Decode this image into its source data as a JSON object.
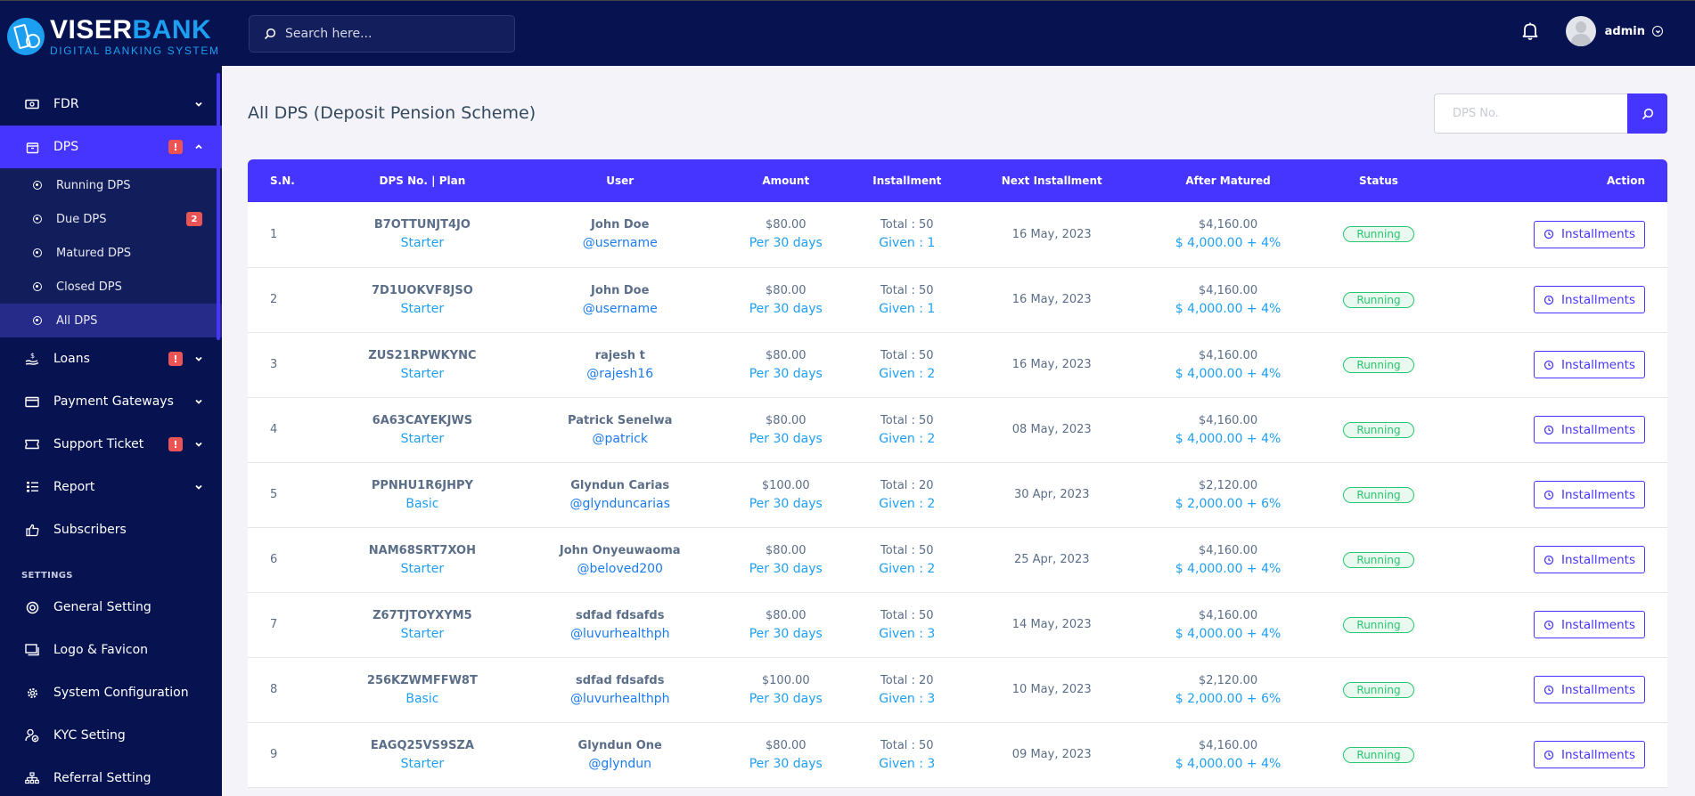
{
  "brand": {
    "name_part1": "VISER",
    "name_part2": "BANK",
    "tagline": "DIGITAL BANKING SYSTEM"
  },
  "sidebar": {
    "items": [
      {
        "label": "FDR",
        "icon": "money-bill-icon",
        "expanded": false
      },
      {
        "label": "DPS",
        "icon": "archive-icon",
        "alert": "!",
        "expanded": true,
        "active": true,
        "children": [
          {
            "label": "Running DPS"
          },
          {
            "label": "Due DPS",
            "badge": "2"
          },
          {
            "label": "Matured DPS"
          },
          {
            "label": "Closed DPS"
          },
          {
            "label": "All DPS",
            "active": true
          }
        ]
      },
      {
        "label": "Loans",
        "icon": "hand-holding-dollar-icon",
        "alert": "!"
      },
      {
        "label": "Payment Gateways",
        "icon": "credit-card-icon"
      },
      {
        "label": "Support Ticket",
        "icon": "ticket-icon",
        "alert": "!"
      },
      {
        "label": "Report",
        "icon": "list-icon"
      },
      {
        "label": "Subscribers",
        "icon": "thumbs-up-icon"
      }
    ],
    "settings_title": "SETTINGS",
    "settings_items": [
      {
        "label": "General Setting",
        "icon": "life-ring-icon"
      },
      {
        "label": "Logo & Favicon",
        "icon": "images-icon"
      },
      {
        "label": "System Configuration",
        "icon": "cog-icon"
      },
      {
        "label": "KYC Setting",
        "icon": "user-check-icon"
      },
      {
        "label": "Referral Setting",
        "icon": "sitemap-icon"
      }
    ]
  },
  "topbar": {
    "search_placeholder": "Search here...",
    "user_name": "admin"
  },
  "page": {
    "title": "All DPS (Deposit Pension Scheme)",
    "dps_search_placeholder": "DPS No."
  },
  "table": {
    "headers": [
      "S.N.",
      "DPS No. | Plan",
      "User",
      "Amount",
      "Installment",
      "Next Installment",
      "After Matured",
      "Status",
      "Action"
    ],
    "rows": [
      {
        "sn": "1",
        "dps_no": "B7OTTUNJT4JO",
        "plan": "Starter",
        "name": "John Doe",
        "username": "@username",
        "amount": "$80.00",
        "per": "Per 30 days",
        "total": "Total : 50",
        "given": "Given : 1",
        "next": "16 May, 2023",
        "matured": "$4,160.00",
        "matured_detail": "$ 4,000.00 + 4%",
        "status": "Running",
        "action": "Installments"
      },
      {
        "sn": "2",
        "dps_no": "7D1UOKVF8JSO",
        "plan": "Starter",
        "name": "John Doe",
        "username": "@username",
        "amount": "$80.00",
        "per": "Per 30 days",
        "total": "Total : 50",
        "given": "Given : 1",
        "next": "16 May, 2023",
        "matured": "$4,160.00",
        "matured_detail": "$ 4,000.00 + 4%",
        "status": "Running",
        "action": "Installments"
      },
      {
        "sn": "3",
        "dps_no": "ZUS21RPWKYNC",
        "plan": "Starter",
        "name": "rajesh t",
        "username": "@rajesh16",
        "amount": "$80.00",
        "per": "Per 30 days",
        "total": "Total : 50",
        "given": "Given : 2",
        "next": "16 May, 2023",
        "matured": "$4,160.00",
        "matured_detail": "$ 4,000.00 + 4%",
        "status": "Running",
        "action": "Installments"
      },
      {
        "sn": "4",
        "dps_no": "6A63CAYEKJWS",
        "plan": "Starter",
        "name": "Patrick Senelwa",
        "username": "@patrick",
        "amount": "$80.00",
        "per": "Per 30 days",
        "total": "Total : 50",
        "given": "Given : 2",
        "next": "08 May, 2023",
        "matured": "$4,160.00",
        "matured_detail": "$ 4,000.00 + 4%",
        "status": "Running",
        "action": "Installments"
      },
      {
        "sn": "5",
        "dps_no": "PPNHU1R6JHPY",
        "plan": "Basic",
        "name": "Glyndun Carias",
        "username": "@glynduncarias",
        "amount": "$100.00",
        "per": "Per 30 days",
        "total": "Total : 20",
        "given": "Given : 2",
        "next": "30 Apr, 2023",
        "matured": "$2,120.00",
        "matured_detail": "$ 2,000.00 + 6%",
        "status": "Running",
        "action": "Installments"
      },
      {
        "sn": "6",
        "dps_no": "NAM68SRT7XOH",
        "plan": "Starter",
        "name": "John Onyeuwaoma",
        "username": "@beloved200",
        "amount": "$80.00",
        "per": "Per 30 days",
        "total": "Total : 50",
        "given": "Given : 2",
        "next": "25 Apr, 2023",
        "matured": "$4,160.00",
        "matured_detail": "$ 4,000.00 + 4%",
        "status": "Running",
        "action": "Installments"
      },
      {
        "sn": "7",
        "dps_no": "Z67TJTOYXYM5",
        "plan": "Starter",
        "name": "sdfad fdsafds",
        "username": "@luvurhealthph",
        "amount": "$80.00",
        "per": "Per 30 days",
        "total": "Total : 50",
        "given": "Given : 3",
        "next": "14 May, 2023",
        "matured": "$4,160.00",
        "matured_detail": "$ 4,000.00 + 4%",
        "status": "Running",
        "action": "Installments"
      },
      {
        "sn": "8",
        "dps_no": "256KZWMFFW8T",
        "plan": "Basic",
        "name": "sdfad fdsafds",
        "username": "@luvurhealthph",
        "amount": "$100.00",
        "per": "Per 30 days",
        "total": "Total : 20",
        "given": "Given : 3",
        "next": "10 May, 2023",
        "matured": "$2,120.00",
        "matured_detail": "$ 2,000.00 + 6%",
        "status": "Running",
        "action": "Installments"
      },
      {
        "sn": "9",
        "dps_no": "EAGQ25VS9SZA",
        "plan": "Starter",
        "name": "Glyndun One",
        "username": "@glyndun",
        "amount": "$80.00",
        "per": "Per 30 days",
        "total": "Total : 50",
        "given": "Given : 3",
        "next": "09 May, 2023",
        "matured": "$4,160.00",
        "matured_detail": "$ 4,000.00 + 4%",
        "status": "Running",
        "action": "Installments"
      }
    ]
  },
  "colors": {
    "sidebar_bg": "#071251",
    "accent": "#4634ff",
    "link_blue": "#1e9ff2",
    "success": "#28c76f",
    "danger": "#ea5455"
  }
}
